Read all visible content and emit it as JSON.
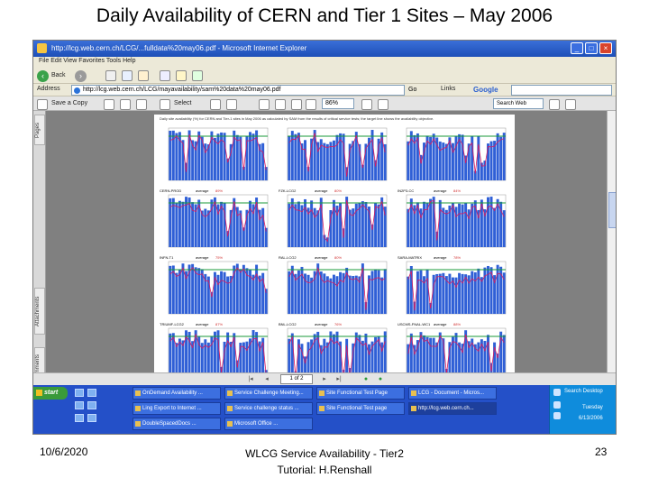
{
  "slide": {
    "title": "Daily Availability of CERN and Tier 1 Sites – May 2006",
    "footer_date": "10/6/2020",
    "footer_line1": "WLCG Service Availability - Tier2",
    "footer_line2": "Tutorial: H.Renshall",
    "page_number": "23"
  },
  "browser": {
    "title": "http://lcg.web.cern.ch/LCG/...fulldata%20may06.pdf - Microsoft Internet Explorer",
    "menu": "File   Edit   View   Favorites   Tools   Help",
    "back_label": "Back",
    "address_label": "Address",
    "address_value": "http://lcg.web.cern.ch/LCG/mayavailability/sam%20data%20may06.pdf",
    "go_label": "Go",
    "links_label": "Links",
    "google_label": "Google",
    "save_copy_label": "Save a Copy",
    "select_label": "Select",
    "zoom_value": "86%",
    "search_web_placeholder": "Search Web",
    "sidetabs": [
      "Pages",
      "Attachments",
      "Comments"
    ],
    "page_indicator": "1 of 2",
    "accent_titlebar": "#1e4fb8",
    "accent_taskbar": "#2450c8"
  },
  "pdf": {
    "header_text": "Daily site availability (%) for CERN and Tier-1 sites in May 2006 as calculated by SAM from the results of critical service tests; the target line shows the availability objective.",
    "avg_label": "average",
    "charts": [
      {
        "site": "CERN-PROD",
        "average": "89%"
      },
      {
        "site": "FZK-LCG2",
        "average": "80%"
      },
      {
        "site": "IN2P3-CC",
        "average": "84%"
      },
      {
        "site": "INFN-T1",
        "average": "75%"
      },
      {
        "site": "RAL-LCG2",
        "average": "80%"
      },
      {
        "site": "SARA-MATRIX",
        "average": "78%"
      },
      {
        "site": "TRIUMF-LCG2",
        "average": "87%"
      },
      {
        "site": "BNL-LCG2",
        "average": "76%"
      },
      {
        "site": "USCMS-FNAL-WC1",
        "average": "88%"
      },
      {
        "site": "PIC",
        "average": "77%"
      },
      {
        "site": "ASGC",
        "average": "88%"
      },
      {
        "site": "NDGF",
        "average": "82%"
      }
    ]
  },
  "taskbar": {
    "start_label": "start",
    "buttons": [
      "OnDemand Availability ...",
      "Service Challenge Meeting...",
      "Site Functional Test Page",
      "LCG - Document - Micros...",
      "Ling Export to Internet ...",
      "Service challenge status ...",
      "Site Functional Test page",
      "DoubleSpacedDocs ...",
      "Microsoft Office ...",
      "http://lcg.web.cern.ch..."
    ],
    "tray_lines": [
      "Search Desktop",
      "Tuesday",
      "6/13/2006"
    ]
  }
}
